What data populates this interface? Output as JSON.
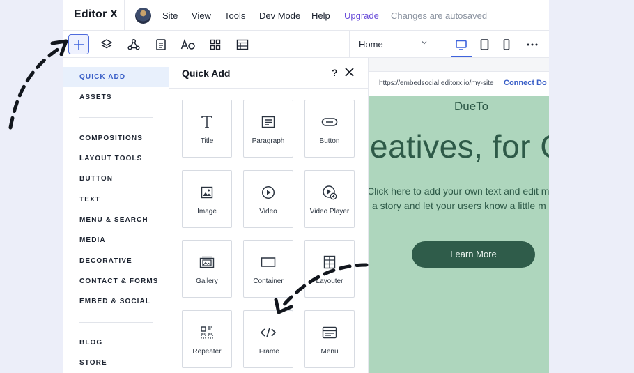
{
  "topbar": {
    "logo": "Editor X",
    "menu": [
      "Site",
      "View",
      "Tools",
      "Dev Mode",
      "Help"
    ],
    "upgrade": "Upgrade",
    "status": "Changes are autosaved"
  },
  "toolbar": {
    "tools": [
      "add-icon",
      "layers-icon",
      "connect-icon",
      "page-icon",
      "theme-icon",
      "apps-icon",
      "table-icon"
    ],
    "page_select": "Home",
    "devices": [
      "desktop-icon",
      "tablet-icon",
      "mobile-icon",
      "more-icon"
    ]
  },
  "categories": {
    "group1": [
      "QUICK ADD",
      "ASSETS"
    ],
    "group2": [
      "COMPOSITIONS",
      "LAYOUT TOOLS",
      "BUTTON",
      "TEXT",
      "MENU & SEARCH",
      "MEDIA",
      "DECORATIVE",
      "CONTACT & FORMS",
      "EMBED & SOCIAL"
    ],
    "group3": [
      "BLOG",
      "STORE"
    ]
  },
  "quick_add": {
    "title": "Quick Add",
    "help": "?",
    "tiles": [
      {
        "label": "Title",
        "icon": "title-icon"
      },
      {
        "label": "Paragraph",
        "icon": "paragraph-icon"
      },
      {
        "label": "Button",
        "icon": "button-icon"
      },
      {
        "label": "Image",
        "icon": "image-icon"
      },
      {
        "label": "Video",
        "icon": "video-icon"
      },
      {
        "label": "Video Player",
        "icon": "video-player-icon"
      },
      {
        "label": "Gallery",
        "icon": "gallery-icon"
      },
      {
        "label": "Container",
        "icon": "container-icon"
      },
      {
        "label": "Layouter",
        "icon": "layouter-icon"
      },
      {
        "label": "Repeater",
        "icon": "repeater-icon"
      },
      {
        "label": "IFrame",
        "icon": "iframe-icon"
      },
      {
        "label": "Menu",
        "icon": "menu-icon"
      }
    ]
  },
  "canvas": {
    "url": "https://embedsocial.editorx.io/my-site",
    "connect": "Connect Do",
    "brand": "DueTo",
    "headline": "eatives, for C",
    "text_line1": "Click here to add your own text and edit m",
    "text_line2": "l a story and let your users know a little m",
    "button": "Learn More"
  },
  "colors": {
    "accent": "#3e63dd",
    "site_background": "#aed6bd",
    "site_primary": "#2f5c4a",
    "upgrade": "#6a4ed9"
  }
}
